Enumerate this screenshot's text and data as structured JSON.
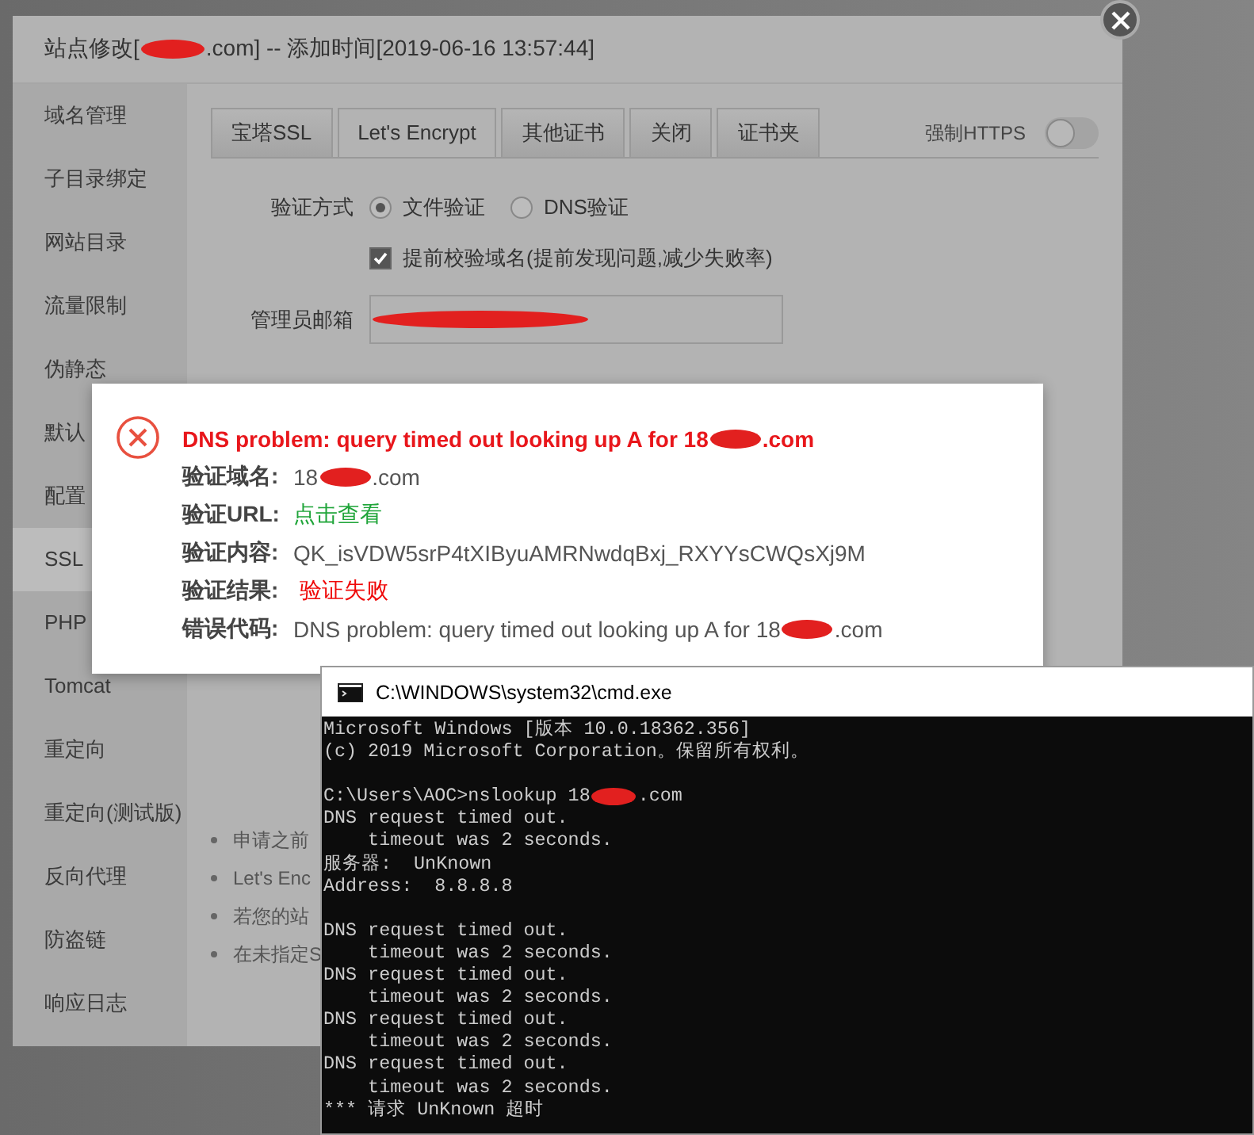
{
  "dialog": {
    "title_before": "站点修改[",
    "title_after": ".com] -- 添加时间[2019-06-16 13:57:44]",
    "sidebar": [
      {
        "label": "域名管理",
        "selected": false
      },
      {
        "label": "子目录绑定",
        "selected": false
      },
      {
        "label": "网站目录",
        "selected": false
      },
      {
        "label": "流量限制",
        "selected": false
      },
      {
        "label": "伪静态",
        "selected": false
      },
      {
        "label": "默认",
        "selected": false
      },
      {
        "label": "配置",
        "selected": false
      },
      {
        "label": "SSL",
        "selected": true
      },
      {
        "label": "PHP",
        "selected": false
      },
      {
        "label": "Tomcat",
        "selected": false
      },
      {
        "label": "重定向",
        "selected": false
      },
      {
        "label": "重定向(测试版)",
        "selected": false
      },
      {
        "label": "反向代理",
        "selected": false
      },
      {
        "label": "防盗链",
        "selected": false
      },
      {
        "label": "响应日志",
        "selected": false
      }
    ],
    "tabs": [
      {
        "label": "宝塔SSL",
        "selected": false
      },
      {
        "label": "Let's Encrypt",
        "selected": true
      },
      {
        "label": "其他证书",
        "selected": false
      },
      {
        "label": "关闭",
        "selected": false
      },
      {
        "label": "证书夹",
        "selected": false
      }
    ],
    "force_https": {
      "label": "强制HTTPS",
      "on": false
    },
    "verify_method": {
      "label": "验证方式",
      "options": [
        {
          "label": "文件验证",
          "selected": true
        },
        {
          "label": "DNS验证",
          "selected": false
        }
      ]
    },
    "precheck": {
      "label": "提前校验域名(提前发现问题,减少失败率)",
      "checked": true
    },
    "admin_email": {
      "label": "管理员邮箱",
      "redacted": true
    },
    "notes": [
      "申请之前",
      "Let's Enc",
      "若您的站",
      "在未指定S"
    ]
  },
  "error_popup": {
    "title": "DNS problem: query timed out looking up A for 18",
    "title_after": ".com",
    "rows": [
      {
        "label": "验证域名:",
        "value": "18",
        "after": ".com",
        "kind": "plain"
      },
      {
        "label": "验证URL:",
        "value": "点击查看",
        "kind": "link"
      },
      {
        "label": "验证内容:",
        "value": "QK_isVDW5srP4tXIByuAMRNwdqBxj_RXYYsCWQsXj9M",
        "kind": "plain"
      },
      {
        "label": "验证结果:",
        "value": "验证失败",
        "kind": "error"
      },
      {
        "label": "错误代码:",
        "value": "DNS problem: query timed out looking up A for 18",
        "after": ".com",
        "kind": "plain"
      }
    ]
  },
  "cmd": {
    "title": "C:\\WINDOWS\\system32\\cmd.exe",
    "blocks": [
      [
        {
          "text": "Microsoft Windows [版本 10.0.18362.356]"
        },
        {
          "text": "(c) 2019 Microsoft Corporation。保留所有权利。"
        }
      ],
      [
        {
          "text": "C:\\Users\\AOC>nslookup 18",
          "after": ".com"
        },
        {
          "text": "DNS request timed out."
        },
        {
          "text": "    timeout was 2 seconds."
        },
        {
          "text": "服务器:  UnKnown"
        },
        {
          "text": "Address:  8.8.8.8"
        }
      ],
      [
        {
          "text": "DNS request timed out."
        },
        {
          "text": "    timeout was 2 seconds."
        },
        {
          "text": "DNS request timed out."
        },
        {
          "text": "    timeout was 2 seconds."
        },
        {
          "text": "DNS request timed out."
        },
        {
          "text": "    timeout was 2 seconds."
        },
        {
          "text": "DNS request timed out."
        },
        {
          "text": "    timeout was 2 seconds."
        },
        {
          "text": "*** 请求 UnKnown 超时"
        }
      ]
    ]
  }
}
